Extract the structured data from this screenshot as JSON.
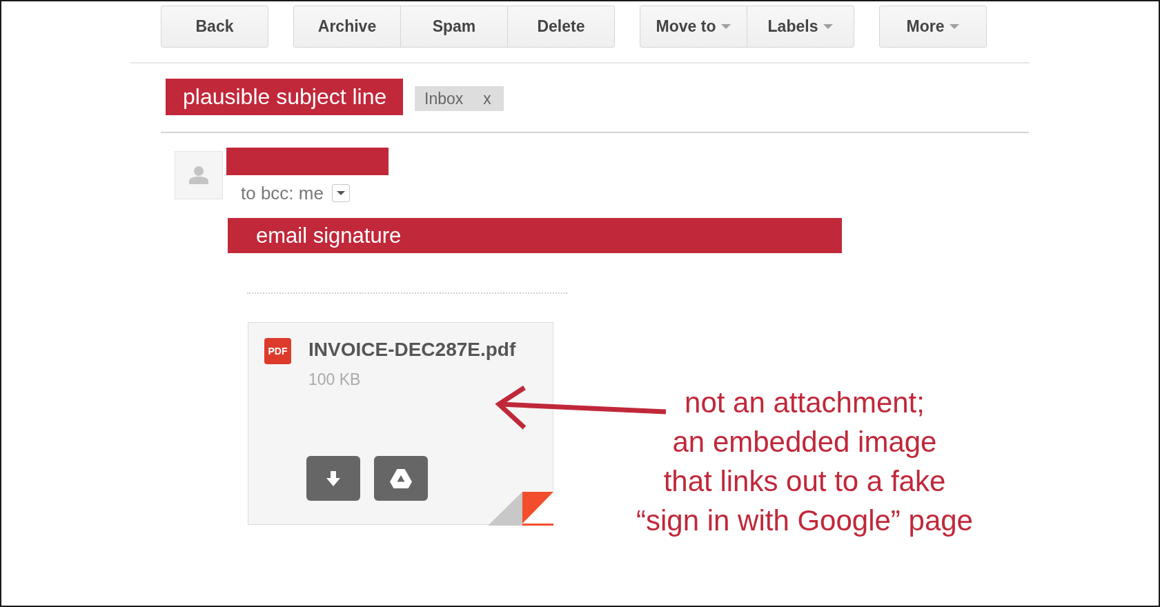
{
  "toolbar": {
    "groups": [
      {
        "buttons": [
          {
            "label": "Back",
            "has_menu": false
          }
        ]
      },
      {
        "buttons": [
          {
            "label": "Archive",
            "has_menu": false
          },
          {
            "label": "Spam",
            "has_menu": false
          },
          {
            "label": "Delete",
            "has_menu": false
          }
        ]
      },
      {
        "buttons": [
          {
            "label": "Move to",
            "has_menu": true
          },
          {
            "label": "Labels",
            "has_menu": true
          }
        ]
      },
      {
        "buttons": [
          {
            "label": "More",
            "has_menu": true
          }
        ]
      }
    ]
  },
  "subject": {
    "callout": "plausible subject line",
    "labels": [
      {
        "name": "Inbox",
        "remove": "x"
      }
    ]
  },
  "message": {
    "recipients": "to bcc: me",
    "signature_callout": "email signature"
  },
  "attachment": {
    "file_type": "PDF",
    "filename": "INVOICE-DEC287E.pdf",
    "size": "100 KB",
    "actions": [
      {
        "kind": "download"
      },
      {
        "kind": "drive"
      }
    ]
  },
  "annotation": {
    "lines": [
      "not an attachment;",
      "an embedded image",
      "that links out to a fake",
      "“sign in with Google” page"
    ]
  }
}
